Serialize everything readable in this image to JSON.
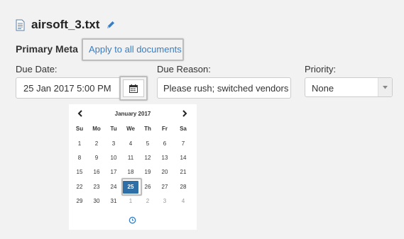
{
  "file": {
    "name": "airsoft_3.txt"
  },
  "primary_meta": {
    "label": "Primary Meta",
    "apply_all_label": "Apply to all documents"
  },
  "fields": {
    "due_date": {
      "label": "Due Date:",
      "value": "25 Jan 2017 5:00 PM"
    },
    "due_reason": {
      "label": "Due Reason:",
      "value": "Please rush; switched vendors"
    },
    "priority": {
      "label": "Priority:",
      "selected": "None"
    }
  },
  "calendar": {
    "month_label": "January 2017",
    "weekdays": [
      "Su",
      "Mo",
      "Tu",
      "We",
      "Th",
      "Fr",
      "Sa"
    ],
    "weeks": [
      [
        {
          "d": "1"
        },
        {
          "d": "2"
        },
        {
          "d": "3"
        },
        {
          "d": "4"
        },
        {
          "d": "5"
        },
        {
          "d": "6"
        },
        {
          "d": "7"
        }
      ],
      [
        {
          "d": "8"
        },
        {
          "d": "9"
        },
        {
          "d": "10"
        },
        {
          "d": "11"
        },
        {
          "d": "12"
        },
        {
          "d": "13"
        },
        {
          "d": "14"
        }
      ],
      [
        {
          "d": "15"
        },
        {
          "d": "16"
        },
        {
          "d": "17"
        },
        {
          "d": "18"
        },
        {
          "d": "19"
        },
        {
          "d": "20"
        },
        {
          "d": "21"
        }
      ],
      [
        {
          "d": "22"
        },
        {
          "d": "23"
        },
        {
          "d": "24"
        },
        {
          "d": "25",
          "selected": true
        },
        {
          "d": "26"
        },
        {
          "d": "27"
        },
        {
          "d": "28"
        }
      ],
      [
        {
          "d": "29"
        },
        {
          "d": "30"
        },
        {
          "d": "31"
        },
        {
          "d": "1",
          "other": true
        },
        {
          "d": "2",
          "other": true
        },
        {
          "d": "3",
          "other": true
        },
        {
          "d": "4",
          "other": true
        }
      ]
    ]
  },
  "icons": {
    "file": "file-text-icon",
    "edit": "pencil-icon",
    "calendar": "calendar-icon",
    "prev": "chevron-left-icon",
    "next": "chevron-right-icon",
    "select": "caret-down-icon",
    "time": "clock-icon"
  },
  "colors": {
    "link": "#3a7dc1",
    "selected_day": "#2f6fa8",
    "page_bg": "#f2f2f2"
  }
}
